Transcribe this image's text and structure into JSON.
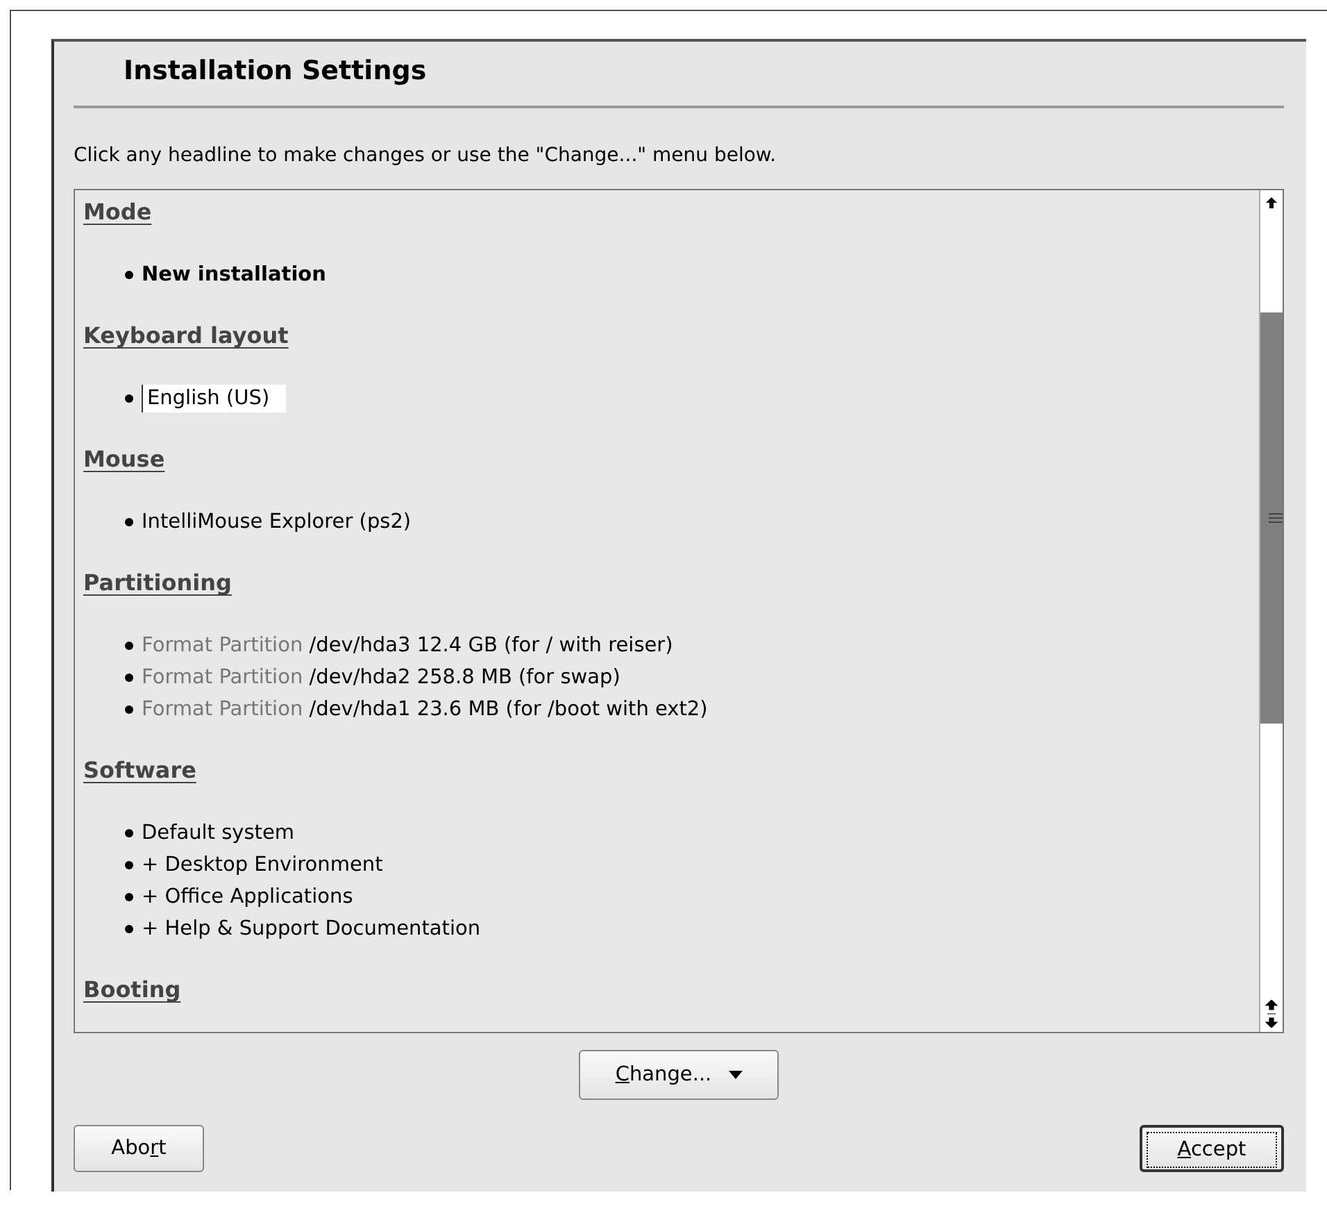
{
  "window": {
    "title": "Installation Settings"
  },
  "instruction": "Click any headline to make changes or use the \"Change...\" menu below.",
  "sections": [
    {
      "heading": "Mode",
      "items": [
        {
          "kind": "bold",
          "text": "New installation"
        }
      ]
    },
    {
      "heading": "Keyboard layout",
      "items": [
        {
          "kind": "highlight",
          "text": "English (US)"
        }
      ]
    },
    {
      "heading": "Mouse",
      "items": [
        {
          "kind": "plain",
          "text": "IntelliMouse Explorer (ps2)"
        }
      ]
    },
    {
      "heading": "Partitioning",
      "items": [
        {
          "kind": "action",
          "action": "Format Partition",
          "text": "/dev/hda3 12.4 GB (for / with reiser)"
        },
        {
          "kind": "action",
          "action": "Format Partition",
          "text": "/dev/hda2 258.8 MB (for swap)"
        },
        {
          "kind": "action",
          "action": "Format Partition",
          "text": "/dev/hda1 23.6 MB (for /boot with ext2)"
        }
      ]
    },
    {
      "heading": "Software",
      "items": [
        {
          "kind": "plain",
          "text": "Default system"
        },
        {
          "kind": "plain",
          "text": "+ Desktop Environment"
        },
        {
          "kind": "plain",
          "text": "+ Office Applications"
        },
        {
          "kind": "plain",
          "text": "+ Help & Support Documentation"
        }
      ]
    },
    {
      "heading": "Booting"
    }
  ],
  "change_button": {
    "mnemonic": "C",
    "label_after": "hange...",
    "dropdown": true
  },
  "buttons": [
    {
      "label_before": "Abo",
      "mnemonic": "r",
      "label_after": "t",
      "focused": false
    },
    {
      "mnemonic": "A",
      "label_after": "ccept",
      "focused": true
    }
  ]
}
